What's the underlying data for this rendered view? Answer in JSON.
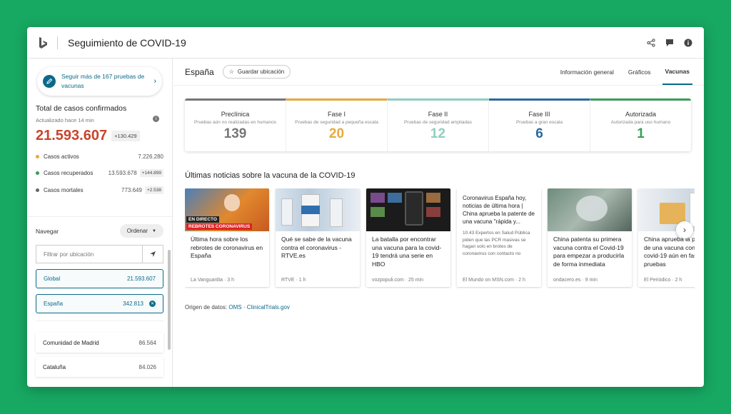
{
  "app": {
    "title": "Seguimiento de COVID-19"
  },
  "icons": {
    "logo": "bing-logo",
    "share": "share-icon",
    "feedback": "feedback-icon",
    "info": "info-icon"
  },
  "sidebar": {
    "vaccine_cta": "Seguir más de 167 pruebas de vacunas",
    "cases": {
      "title": "Total de casos confirmados",
      "updated": "Actualizado hace 14 min",
      "total": "21.593.607",
      "total_delta": "+130.429",
      "stats": [
        {
          "label": "Casos activos",
          "value": "7.226.280",
          "delta": "",
          "color": "#e8a93a"
        },
        {
          "label": "Casos recuperados",
          "value": "13.593.678",
          "delta": "+144.899",
          "color": "#3a9d5a"
        },
        {
          "label": "Casos mortales",
          "value": "773.649",
          "delta": "+2.538",
          "color": "#666666"
        }
      ]
    },
    "nav": {
      "label": "Navegar",
      "order": "Ordenar",
      "filter_placeholder": "Filtrar por ubicación",
      "locations": [
        {
          "name": "Global",
          "value": "21.593.607"
        },
        {
          "name": "España",
          "value": "342.813"
        }
      ],
      "regions": [
        {
          "name": "Comunidad de Madrid",
          "value": "86.564"
        },
        {
          "name": "Cataluña",
          "value": "84.026"
        }
      ]
    }
  },
  "main": {
    "country": "España",
    "save_location": "Guardar ubicación",
    "tabs": [
      "Información general",
      "Gráficos",
      "Vacunas"
    ],
    "active_tab": "Vacunas",
    "phases": [
      {
        "name": "Preclínica",
        "desc": "Pruebas aún no realizadas en humanos",
        "count": "139",
        "color": "#777777"
      },
      {
        "name": "Fase I",
        "desc": "Pruebas de seguridad a pequeña escala",
        "count": "20",
        "color": "#e8a93a"
      },
      {
        "name": "Fase II",
        "desc": "Pruebas de seguridad ampliadas",
        "count": "12",
        "color": "#8fcfc0"
      },
      {
        "name": "Fase III",
        "desc": "Pruebas a gran escala",
        "count": "6",
        "color": "#2b6a9e"
      },
      {
        "name": "Autorizada",
        "desc": "Autorizada para uso humano",
        "count": "1",
        "color": "#3a9d5a"
      }
    ],
    "news_title": "Últimas noticias sobre la vacuna de la COVID-19",
    "news": [
      {
        "title": "Última hora sobre los rebrotes de coronavirus en España",
        "source": "La Vanguardia · 3 h",
        "tag1": "EN DIRECTO",
        "tag2": "REBROTES CORONAVIRUS"
      },
      {
        "title": "Qué se sabe de la vacuna contra el coronavirus - RTVE.es",
        "source": "RTVE · 1 h"
      },
      {
        "title": "La batalla por encontrar una vacuna para la covid-19 tendrá una serie en HBO",
        "source": "vozpopuli.com · 25 min"
      },
      {
        "title": "Coronavirus España hoy, noticias de última hora | China aprueba la patente de una vacuna \"rápida y...",
        "snippet": "10.43 Expertos en Salud Pública piden que las PCR masivas se hagan solo en brotes de coronavirus con contacto no",
        "source": "El Mundo on MSN.com · 2 h"
      },
      {
        "title": "China patenta su primera vacuna contra el Covid-19 para empezar a producirla de forma inmediata",
        "source": "ondacero.es · 9 min"
      },
      {
        "title": "China aprueba la patente de una vacuna contra el covid-19 aún en fase de pruebas",
        "source": "El Periódico · 2 h"
      }
    ],
    "sources_label": "Origen de datos:",
    "sources": [
      "OMS",
      "ClinicalTrials.gov"
    ]
  }
}
